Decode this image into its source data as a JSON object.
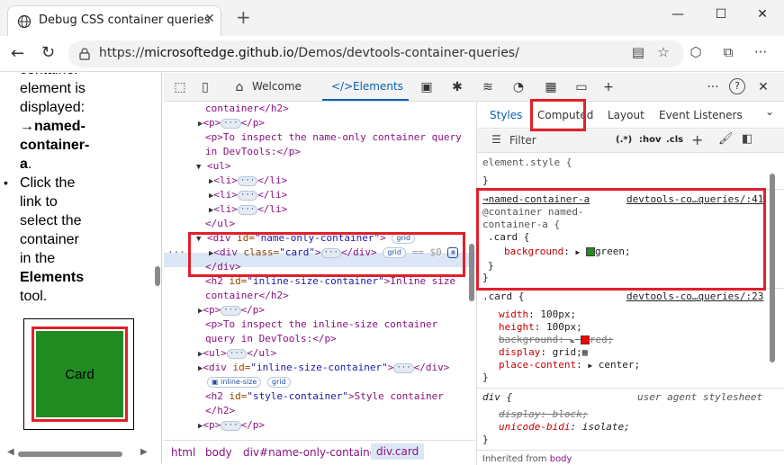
{
  "browser": {
    "tab_title": "Debug CSS container queries",
    "tab_close": "✕",
    "new_tab": "+",
    "url_prefix": "https://",
    "url_host": "microsoftedge.github.io",
    "url_path": "/Demos/devtools-container-queries/",
    "window_minimize": "—",
    "window_maximize": "☐",
    "window_close": "✕"
  },
  "page": {
    "line1": "container",
    "line2": "element is",
    "line3": "displayed:",
    "line4_arrow": "→",
    "line4": "named-",
    "line5": "container-",
    "line6": "a",
    "line6_end": ".",
    "bullet": "•",
    "b_line1": "Click the",
    "b_line2": "link to",
    "b_line3": "select the",
    "b_line4": "container",
    "b_line5": "in the",
    "b_line6": "Elements",
    "b_line7": "tool.",
    "card_label": "Card"
  },
  "devtools": {
    "tabs": {
      "welcome": "Welcome",
      "elements": "Elements",
      "elements_icon": "</>"
    },
    "more": "···",
    "help": "?",
    "close": "✕",
    "elements_lines": {
      "l0": "container</h2>",
      "l1_open": "<p>",
      "l1_close": "</p>",
      "l2": "<p>To inspect the name-only container query",
      "l3": "in DevTools:</p>",
      "l4": "<ul>",
      "li_open": "<li>",
      "li_close": "</li>",
      "l8": "</ul>",
      "div_open": "<div ",
      "div_id_attr": "id=",
      "div_id_val": "\"name-only-container\"",
      "div_gt": ">",
      "grid": "grid",
      "card_div_open": "<div ",
      "card_class_attr": "class=",
      "card_class_val": "\"card\"",
      "card_div_mid": ">",
      "card_div_close": "</div>",
      "eq": "== $0",
      "div_end": "</div>",
      "h2_open": "<h2 ",
      "h2_id_attr": "id=",
      "h2_id_val": "\"inline-size-container\"",
      "h2_text": ">Inline size",
      "h2_cont": "container</h2>",
      "p2_open": "<p>",
      "p2_close": "</p>",
      "p3": "<p>To inspect the inline-size container",
      "p4": "query in DevTools:</p>",
      "ul2_open": "<ul>",
      "ul2_close": "</ul>",
      "div2_open": "<div ",
      "div2_id_attr": "id=",
      "div2_id_val": "\"inline-size-container\"",
      "div2_gt": ">",
      "div2_close": "</div>",
      "inline_size": "inline-size",
      "h2b_open": "<h2 ",
      "h2b_id_attr": "id=",
      "h2b_id_val": "\"style-container\"",
      "h2b_text": ">Style container",
      "h2b_close": "</h2>",
      "p5_open": "<p>",
      "p5_close": "</p>"
    },
    "breadcrumbs": [
      "html",
      "body",
      "div#name-only-container",
      "div.card"
    ],
    "styles_tabs": [
      "Styles",
      "Computed",
      "Layout",
      "Event Listeners"
    ],
    "filter_placeholder": "Filter",
    "hov": ":hov",
    "cls": ".cls",
    "pseudo": "(.*)",
    "element_style": "element.style {",
    "close_brace": "}",
    "rule1": {
      "container_link": "→named-container-a",
      "source": "devtools-co…queries/:41",
      "at_rule": "@container named-",
      "at_rule2": "container-a {",
      "selector": ".card {",
      "prop": "background",
      "value": "green;",
      "inner_close": "}",
      "outer_close": "}"
    },
    "rule2": {
      "selector": ".card {",
      "source": "devtools-co…queries/:23",
      "width_p": "width",
      "width_v": "100px;",
      "height_p": "height",
      "height_v": "100px;",
      "bg_p": "background",
      "bg_v": "red;",
      "display_p": "display",
      "display_v": "grid;",
      "place_p": "place-content",
      "place_v": "center;",
      "close": "}"
    },
    "rule3": {
      "selector": "div {",
      "source": "user agent stylesheet",
      "display_p": "display",
      "display_v": "block;",
      "ub_p": "unicode-bidi",
      "ub_v": "isolate;",
      "close": "}"
    },
    "inherited": "Inherited from ",
    "inherited_el": "body"
  },
  "colors": {
    "highlight": "#e0202a",
    "card_green": "#228b22",
    "accent": "#0a5fb4"
  }
}
